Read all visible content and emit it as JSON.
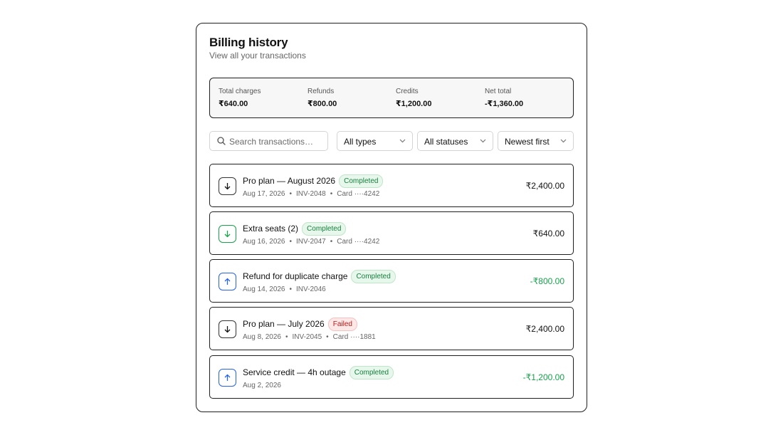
{
  "header": {
    "title": "Billing history",
    "subtitle": "View all your transactions"
  },
  "summary": [
    {
      "label": "Total charges",
      "value": "₹640.00"
    },
    {
      "label": "Refunds",
      "value": "₹800.00"
    },
    {
      "label": "Credits",
      "value": "₹1,200.00"
    },
    {
      "label": "Net total",
      "value": "-₹1,360.00"
    }
  ],
  "filters": {
    "search_placeholder": "Search transactions…",
    "type": "All types",
    "status": "All statuses",
    "sort": "Newest first"
  },
  "transactions": [
    {
      "name": "Pro plan — August 2026",
      "status": "Completed",
      "date": "Aug 17, 2026",
      "invoice": "INV-2048",
      "payment": "Card ····4242",
      "amount": "₹2,400.00",
      "direction": "down",
      "icon": "arrow-down-icon"
    },
    {
      "name": "Extra seats (2)",
      "status": "Completed",
      "date": "Aug 16, 2026",
      "invoice": "INV-2047",
      "payment": "Card ····4242",
      "amount": "₹640.00",
      "direction": "down",
      "icon": "arrow-down-icon"
    },
    {
      "name": "Refund for duplicate charge",
      "status": "Completed",
      "date": "Aug 14, 2026",
      "invoice": "INV-2046",
      "amount": "-₹800.00",
      "direction": "up",
      "icon": "arrow-up-icon"
    },
    {
      "name": "Pro plan — July 2026",
      "status": "Failed",
      "date": "Aug 8, 2026",
      "invoice": "INV-2045",
      "payment": "Card ····1881",
      "amount": "₹2,400.00",
      "direction": "down",
      "icon": "arrow-down-icon"
    },
    {
      "name": "Service credit — 4h outage",
      "status": "Completed",
      "date": "Aug 2, 2026",
      "amount": "-₹1,200.00",
      "direction": "up",
      "icon": "arrow-up-icon"
    }
  ],
  "colors": {
    "success": "#16a34a",
    "danger": "#b91c1c",
    "refund_icon": "#2563eb"
  }
}
